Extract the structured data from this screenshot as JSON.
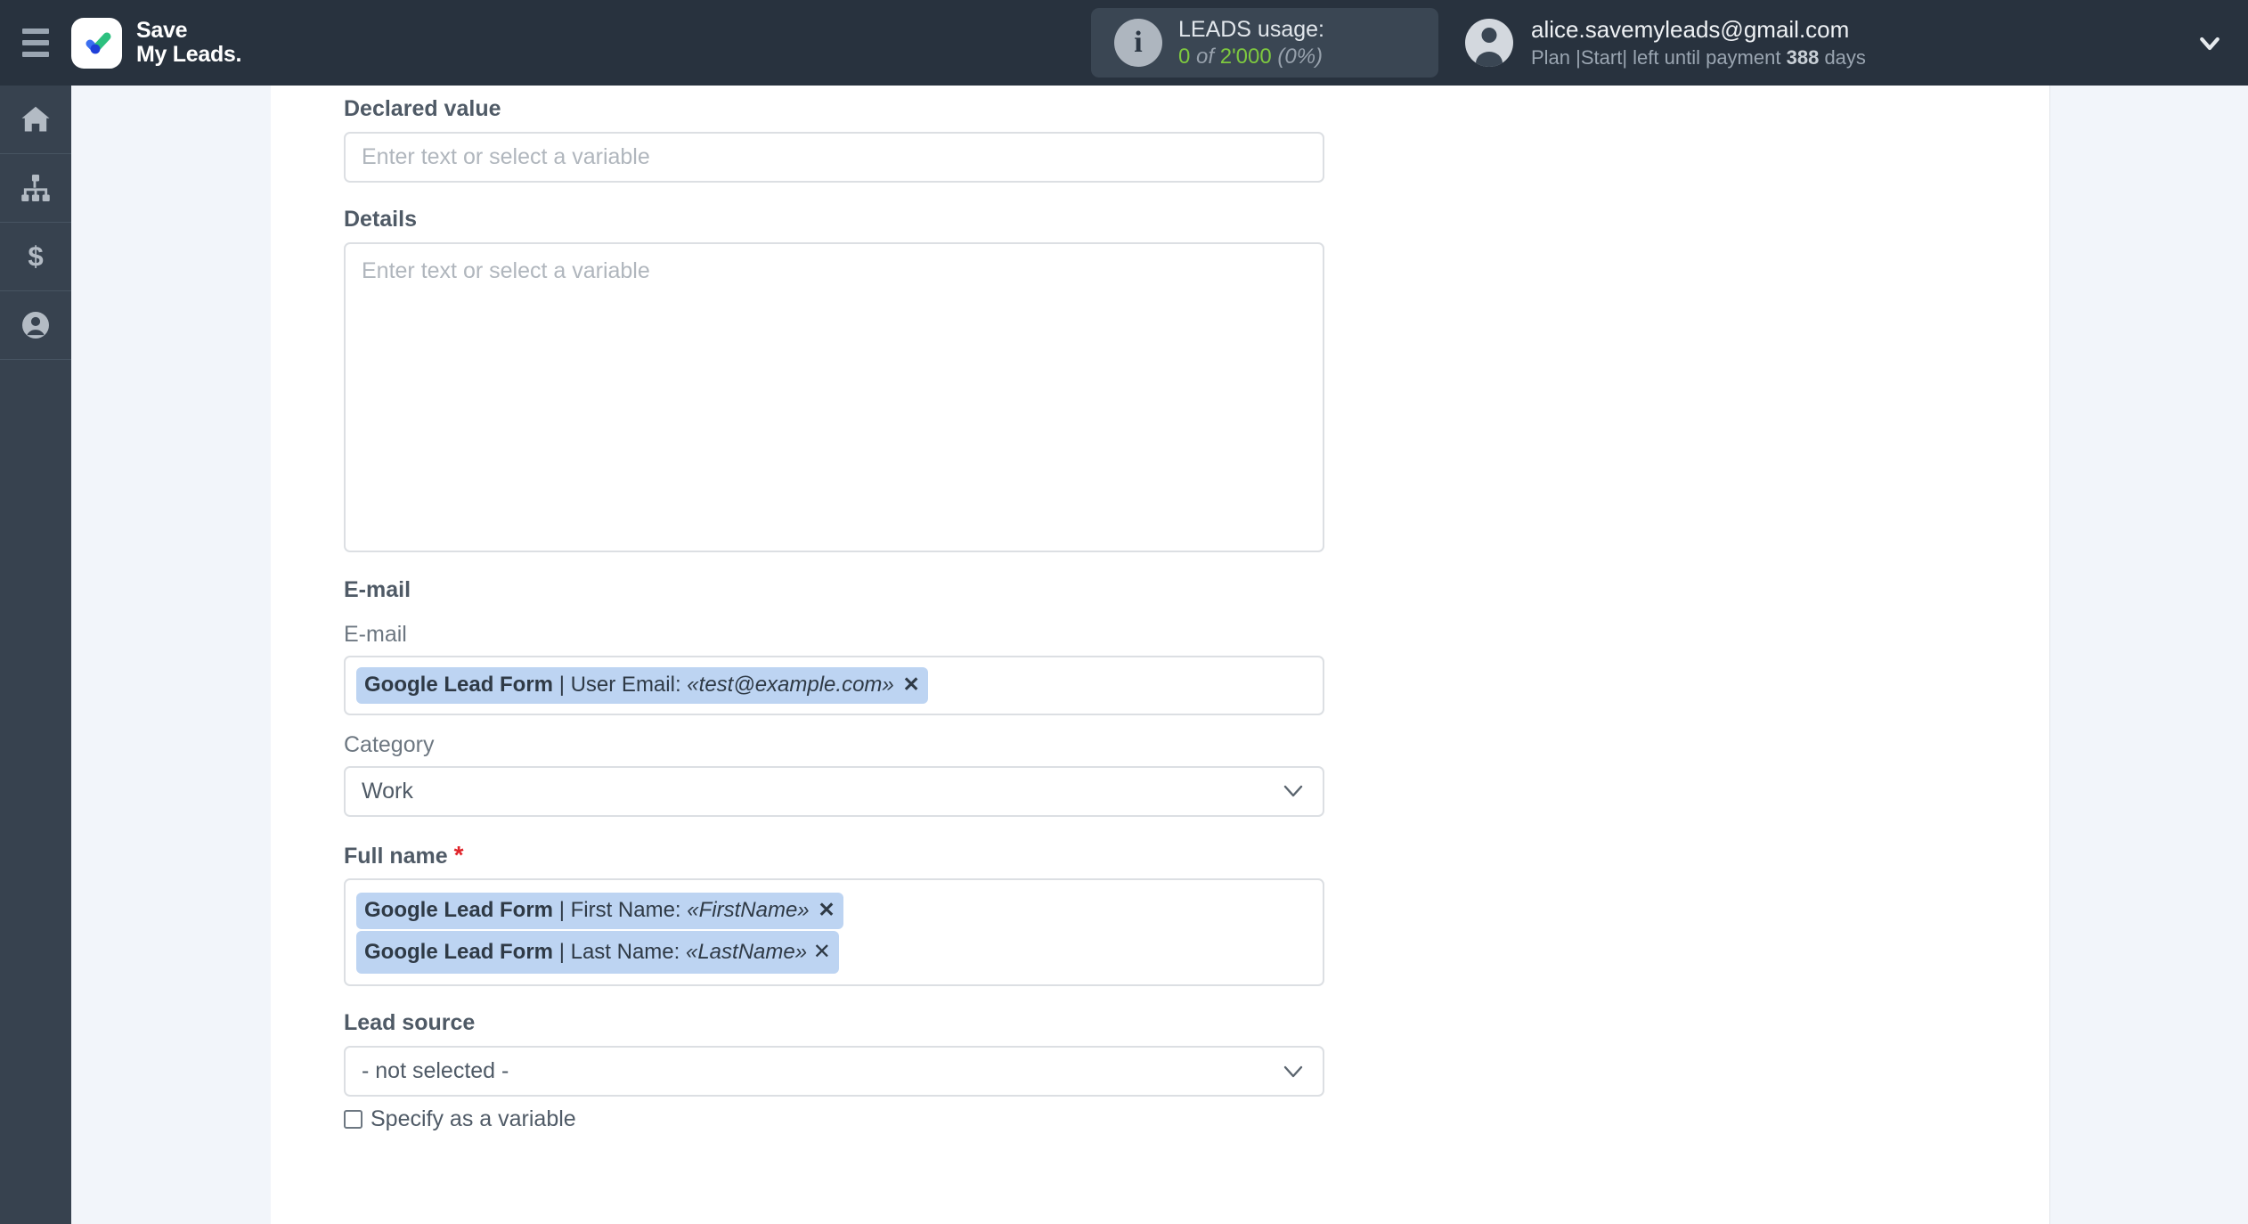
{
  "header": {
    "menu_icon": "hamburger-icon",
    "brand_line1": "Save",
    "brand_line2": "My Leads.",
    "usage": {
      "info_icon": "info-icon",
      "title": "LEADS usage:",
      "used": "0",
      "of": "of",
      "limit": "2'000",
      "percent": "(0%)",
      "accent_color": "#7ec93f"
    },
    "account": {
      "avatar_icon": "user-avatar-icon",
      "email": "alice.savemyleads@gmail.com",
      "plan_prefix": "Plan |Start| left until payment",
      "days_value": "388",
      "days_unit": "days",
      "caret_icon": "chevron-down-icon"
    }
  },
  "sidebar": {
    "items": [
      {
        "name": "home",
        "icon": "home-icon"
      },
      {
        "name": "connections",
        "icon": "sitemap-icon"
      },
      {
        "name": "billing",
        "icon": "dollar-icon"
      },
      {
        "name": "profile",
        "icon": "user-circle-icon"
      }
    ]
  },
  "form": {
    "placeholder_text": "Enter text or select a variable",
    "declared_value": {
      "label": "Declared value",
      "value": ""
    },
    "details": {
      "label": "Details",
      "value": ""
    },
    "email_section": {
      "heading": "E-mail",
      "email_label": "E-mail",
      "chip": {
        "source": "Google Lead Form",
        "separator": "|",
        "field": "User Email:",
        "variable": "«test@example.com»",
        "remove_icon": "remove-chip-icon",
        "remove_glyph": "✕"
      },
      "category_label": "Category",
      "category_value": "Work",
      "category_caret": "chevron-down-icon"
    },
    "full_name": {
      "label": "Full name",
      "required_marker": "*",
      "chips": [
        {
          "source": "Google Lead Form",
          "separator": "|",
          "field": "First Name:",
          "variable": "«FirstName»",
          "remove_glyph": "✕"
        },
        {
          "source": "Google Lead Form",
          "separator": "|",
          "field": "Last Name:",
          "variable": "«LastName»",
          "remove_glyph": "✕"
        }
      ]
    },
    "lead_source": {
      "label": "Lead source",
      "value": "- not selected -",
      "caret": "chevron-down-icon",
      "checkbox_label": "Specify as a variable",
      "checkbox_checked": false
    }
  }
}
